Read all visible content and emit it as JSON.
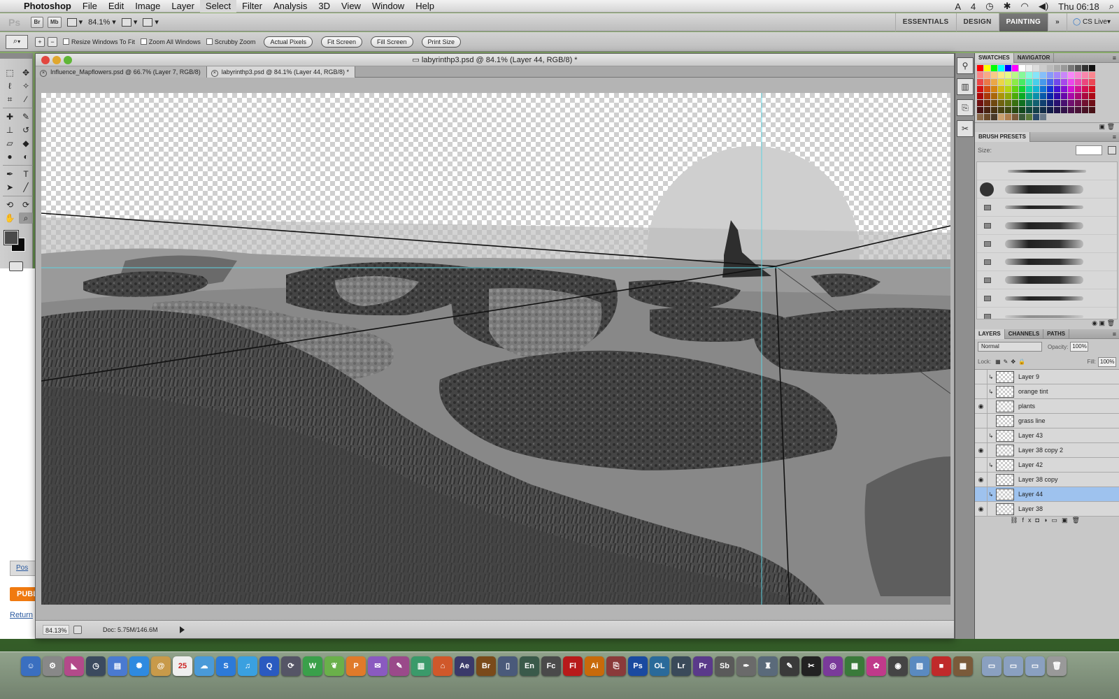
{
  "menubar": {
    "app": "Photoshop",
    "items": [
      "File",
      "Edit",
      "Image",
      "Layer",
      "Select",
      "Filter",
      "Analysis",
      "3D",
      "View",
      "Window",
      "Help"
    ],
    "status_badge": "4",
    "clock": "Thu 06:18"
  },
  "appbar": {
    "logo": "Ps",
    "bridge": "Br",
    "minibridge": "Mb",
    "zoom": "84.1%",
    "workspaces": [
      "ESSENTIALS",
      "DESIGN",
      "PAINTING"
    ],
    "active_workspace": "PAINTING",
    "more": "»",
    "cslive": "CS Live"
  },
  "options": {
    "checks": [
      "Resize Windows To Fit",
      "Zoom All Windows",
      "Scrubby Zoom"
    ],
    "buttons": [
      "Actual Pixels",
      "Fit Screen",
      "Fill Screen",
      "Print Size"
    ]
  },
  "document": {
    "title": "labyrinthp3.psd @ 84.1% (Layer 44, RGB/8) *",
    "tabs": [
      {
        "label": "Influence_Mapflowers.psd @ 66.7% (Layer 7, RGB/8)"
      },
      {
        "label": "labyrinthp3.psd @ 84.1% (Layer 44, RGB/8) *"
      }
    ],
    "status_zoom": "84.13%",
    "doc_size": "Doc: 5.75M/146.6M"
  },
  "panels": {
    "swatches_tab": "SWATCHES",
    "navigator_tab": "NAVIGATOR",
    "brush_presets_tab": "BRUSH PRESETS",
    "brush_size_label": "Size:",
    "layers_tab": "LAYERS",
    "channels_tab": "CHANNELS",
    "paths_tab": "PATHS",
    "blend_mode": "Normal",
    "opacity_label": "Opacity:",
    "opacity": "100%",
    "lock_label": "Lock:",
    "fill_label": "Fill:",
    "fill": "100%",
    "layers": [
      {
        "name": "Layer 9",
        "visible": false,
        "clipped": true,
        "selected": false
      },
      {
        "name": "orange tint",
        "visible": false,
        "clipped": true,
        "selected": false
      },
      {
        "name": "plants",
        "visible": true,
        "clipped": false,
        "selected": false
      },
      {
        "name": "grass line",
        "visible": false,
        "clipped": false,
        "selected": false
      },
      {
        "name": "Layer 43",
        "visible": false,
        "clipped": true,
        "selected": false
      },
      {
        "name": "Layer 38 copy 2",
        "visible": true,
        "clipped": false,
        "selected": false
      },
      {
        "name": "Layer 42",
        "visible": false,
        "clipped": true,
        "selected": false
      },
      {
        "name": "Layer 38 copy",
        "visible": true,
        "clipped": false,
        "selected": false
      },
      {
        "name": "Layer 44",
        "visible": false,
        "clipped": true,
        "selected": true
      },
      {
        "name": "Layer 38",
        "visible": true,
        "clipped": false,
        "selected": false
      }
    ]
  },
  "webpage_behind": {
    "post_link": "Pos",
    "publish": "PUBL",
    "return_link": "Return"
  },
  "dock": {
    "calendar_day": "25",
    "labeled_apps": [
      "Ae",
      "Br",
      "En",
      "Fc",
      "Fl",
      "Ai",
      "Ps",
      "OL",
      "Lr",
      "Pr",
      "Sb"
    ]
  },
  "colors": {
    "foreground": "#4a4a4a",
    "background": "#0a0a0a",
    "selected_layer": "#9ec2ee",
    "guide": "#5fd3e0"
  }
}
